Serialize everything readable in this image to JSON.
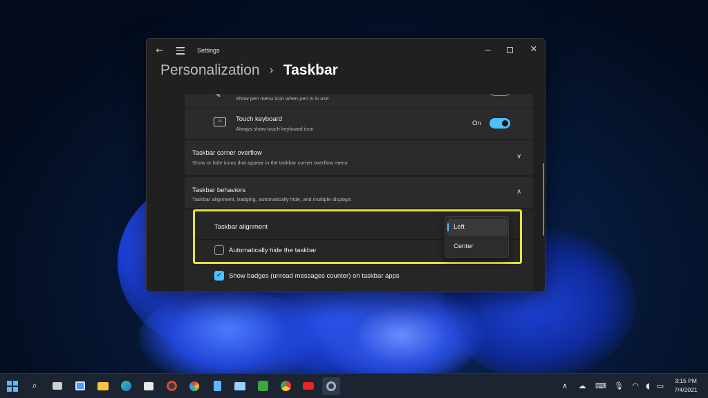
{
  "window": {
    "app_title": "Settings",
    "breadcrumb": {
      "parent": "Personalization",
      "separator": "›",
      "current": "Taskbar"
    }
  },
  "rows": {
    "pen_menu": {
      "subtitle": "Show pen menu icon when pen is in use",
      "state": "Off"
    },
    "touch_keyboard": {
      "title": "Touch keyboard",
      "subtitle": "Always show touch keyboard icon",
      "state": "On"
    },
    "corner_overflow": {
      "title": "Taskbar corner overflow",
      "subtitle": "Show or hide icons that appear in the taskbar corner overflow menu"
    },
    "behaviors": {
      "title": "Taskbar behaviors",
      "subtitle": "Taskbar alignment, badging, automatically hide, and multiple displays"
    },
    "alignment": {
      "label": "Taskbar alignment",
      "options": [
        "Left",
        "Center"
      ],
      "selected": "Left"
    },
    "auto_hide": {
      "label": "Automatically hide the taskbar",
      "checked": false
    },
    "badges": {
      "label": "Show badges (unread messages counter) on taskbar apps",
      "checked": true
    }
  },
  "taskbar": {
    "clock_time": "3:15 PM",
    "clock_date": "7/4/2021",
    "apps": [
      "start-icon",
      "search-icon",
      "task-view-icon",
      "widgets-icon",
      "file-explorer-icon",
      "edge-icon",
      "store-icon",
      "music-icon",
      "paint-icon",
      "notepad-icon",
      "photos-icon",
      "camtasia-icon",
      "chrome-icon",
      "youtube-icon",
      "settings-icon"
    ]
  },
  "colors": {
    "accent": "#4cc2ff",
    "highlight_box": "#e6e43a",
    "card": "#2b2b2b",
    "window": "#202020"
  }
}
